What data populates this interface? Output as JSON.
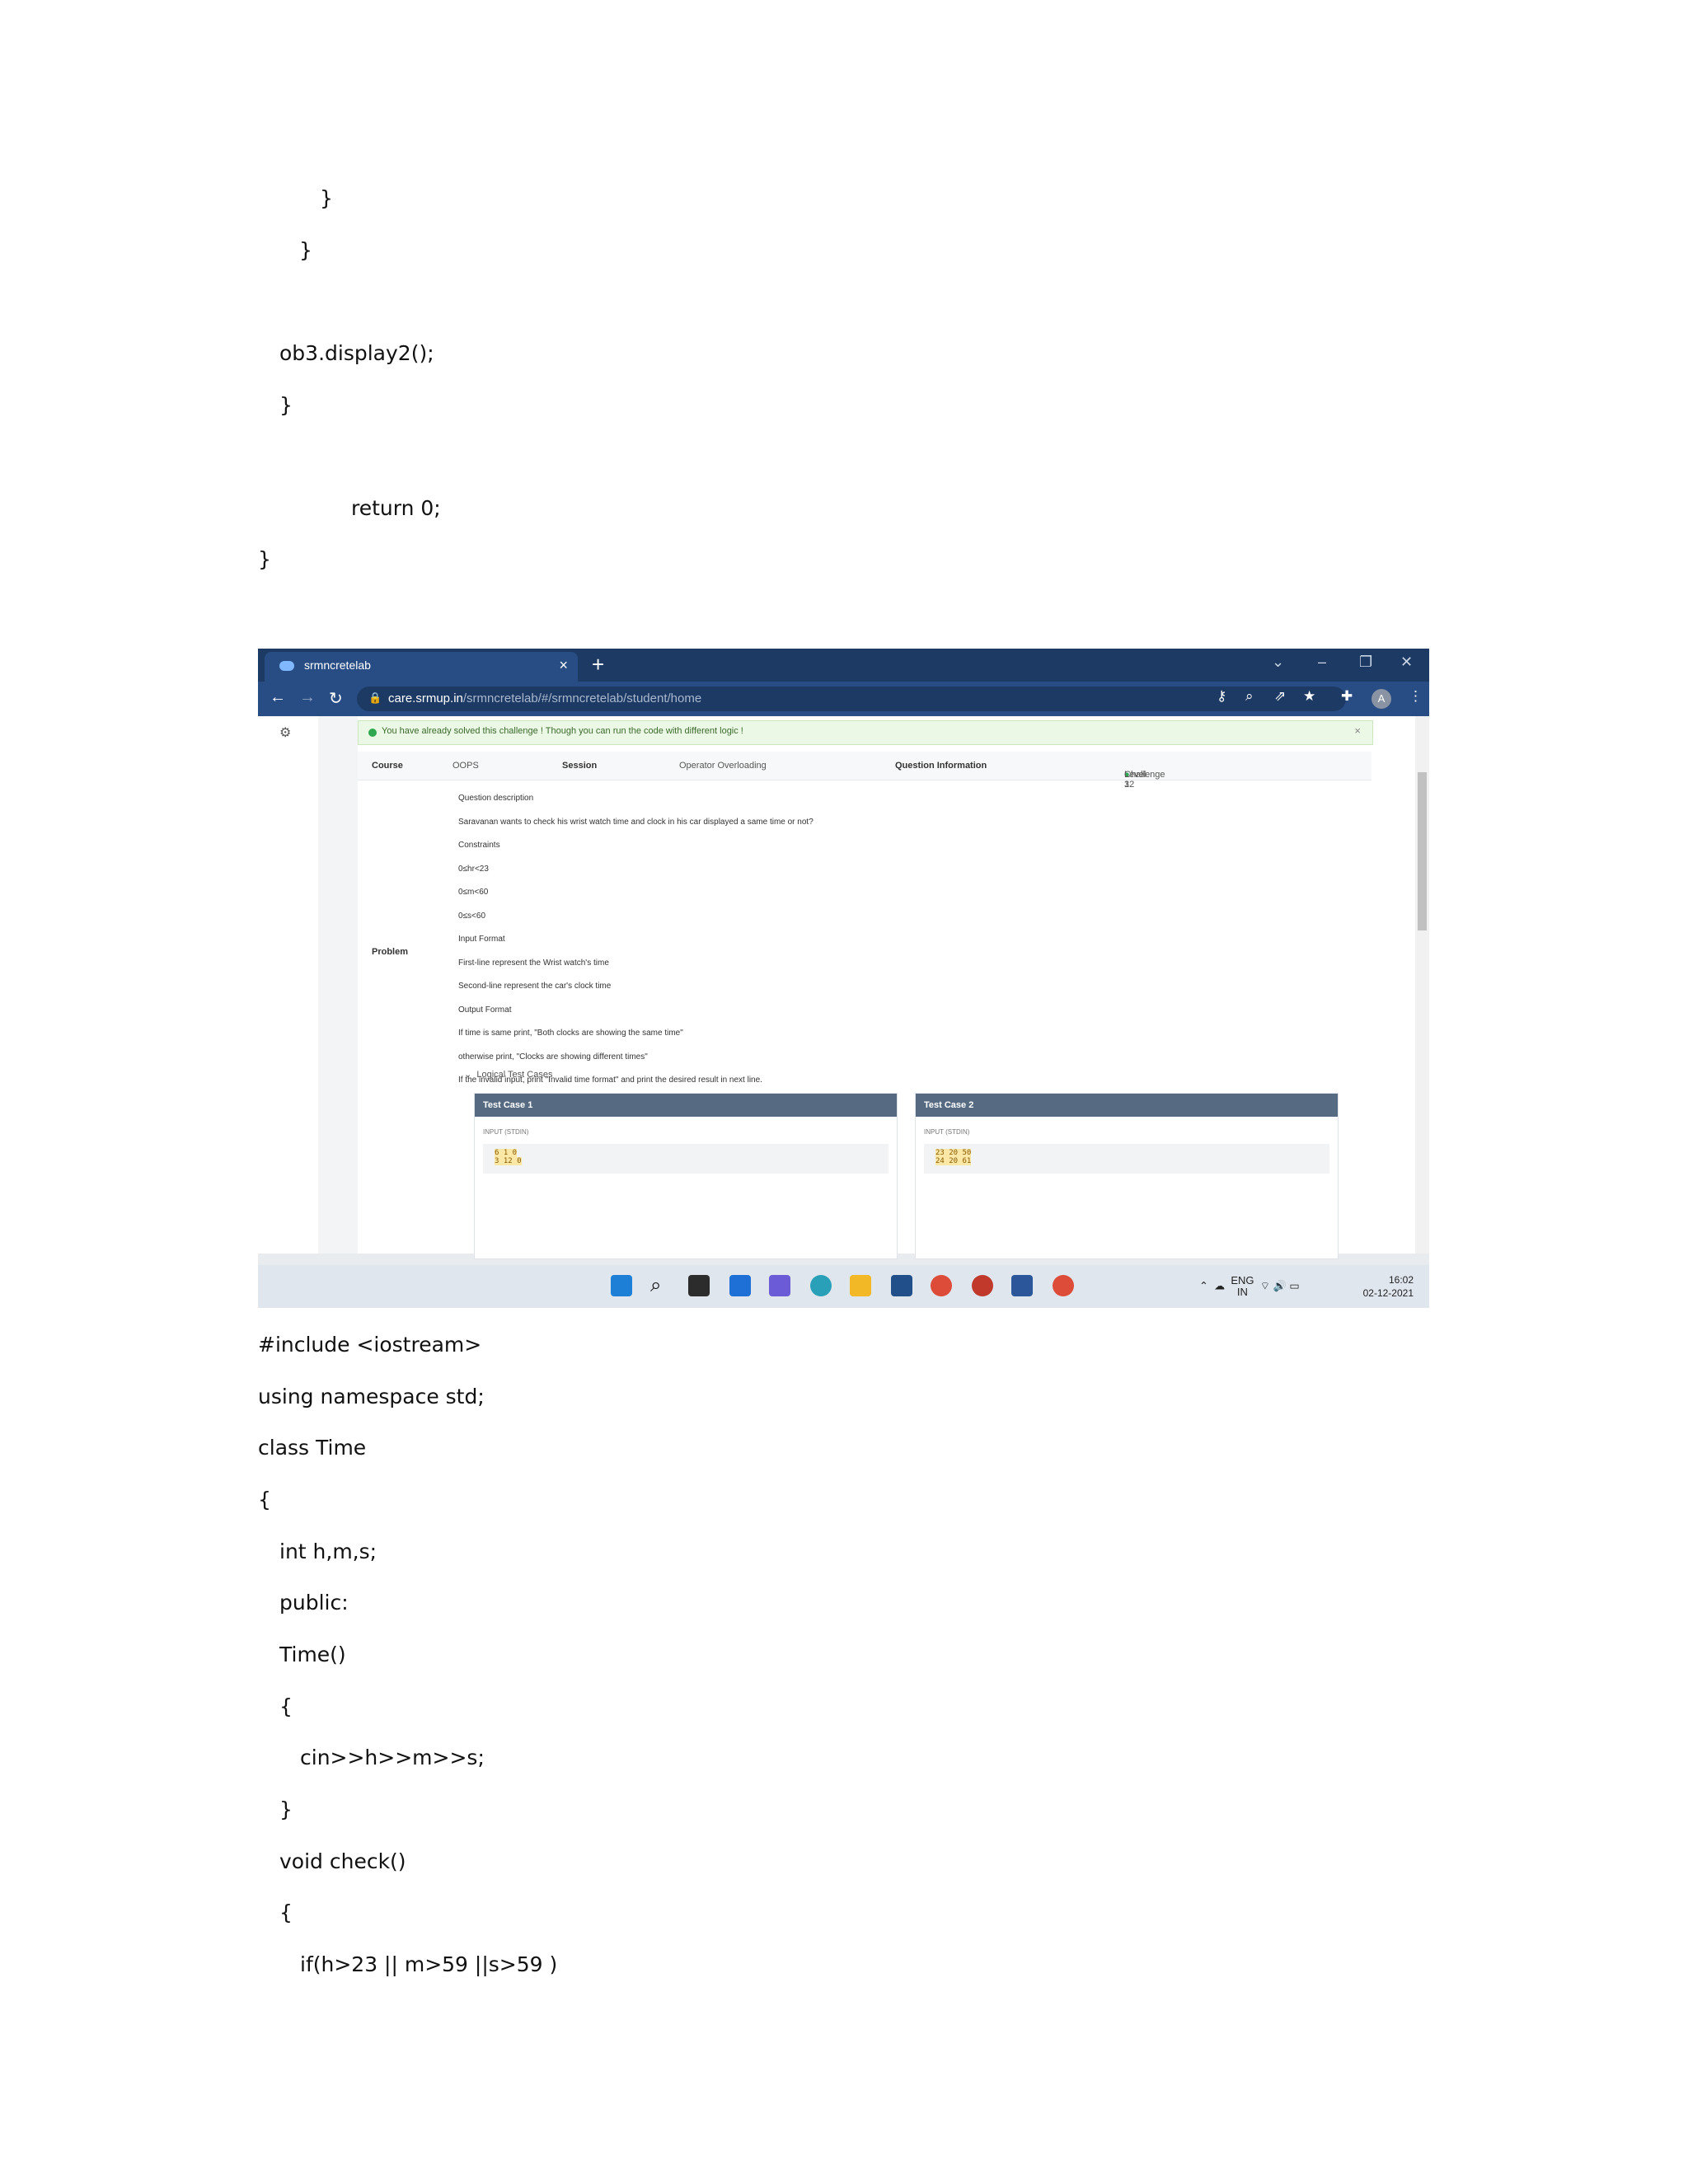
{
  "top_code": [
    "}",
    "}",
    "ob3.display2();",
    "}",
    "return 0;",
    "}"
  ],
  "browser": {
    "tab_title": "srmncretelab",
    "new_tab": "+",
    "url_host": "care.srmup.in",
    "url_path": "/srmncretelab/#/srmncretelab/student/home",
    "avatar": "A"
  },
  "banner": "You have already solved this challenge ! Though you can run the code with different logic !",
  "info": {
    "course_label": "Course",
    "course_value": "OOPS",
    "session_label": "Session",
    "session_value": "Operator Overloading",
    "question_label": "Question Information",
    "level": "Level 1",
    "challenge": "Challenge 32"
  },
  "problem_label": "Problem",
  "problem_lines": [
    "Question description",
    "Saravanan wants to check his wrist watch time and clock in his car displayed a same time or not?",
    "Constraints",
    "0≤hr<23",
    "0≤m<60",
    "0≤s<60",
    "Input Format",
    "First-line represent the Wrist watch's time",
    "Second-line represent  the car's clock time",
    "Output Format",
    "If time is same print, \"Both clocks are showing the same time\"",
    "otherwise print, \"Clocks are showing different times\"",
    "If the invalid input, print  \"Invalid time format\" and print the desired result in next line."
  ],
  "test_cases": {
    "toggle": "Logical Test Cases",
    "cases": [
      {
        "title": "Test Case 1",
        "sub": "INPUT (STDIN)",
        "line1": "6 1 0",
        "line2": "3 12 0"
      },
      {
        "title": "Test Case 2",
        "sub": "INPUT (STDIN)",
        "line1": "23 20 50",
        "line2": "24 20 61"
      }
    ]
  },
  "taskbar": {
    "lang": "ENG",
    "region": "IN",
    "time": "16:02",
    "date": "02-12-2021"
  },
  "bottom_code": [
    "#include <iostream>",
    "using namespace std;",
    "class Time",
    "{",
    "int h,m,s;",
    "public:",
    "Time()",
    "{",
    "cin>>h>>m>>s;",
    "}",
    "void check()",
    "{",
    "if(h>23 || m>59 ||s>59 )"
  ]
}
